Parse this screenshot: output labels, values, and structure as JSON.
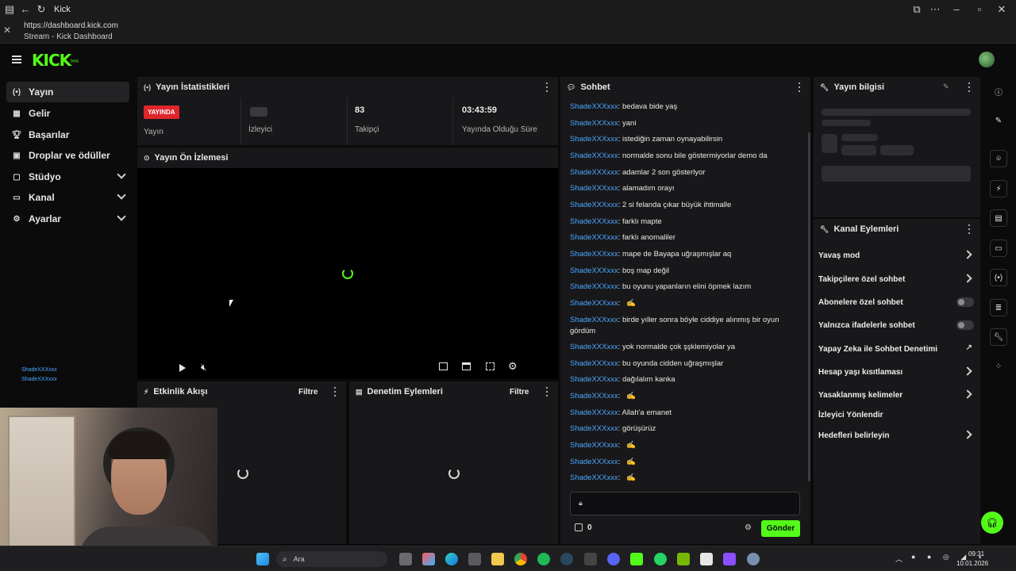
{
  "browser": {
    "tab_title": "Kick",
    "url": "https://dashboard.kick.com",
    "page_title": "Stream - Kick Dashboard"
  },
  "brand": {
    "logo_text": "KICK",
    "logo_sup": "beta",
    "accent": "#53fc18"
  },
  "sidebar": {
    "items": [
      {
        "label": "Yayın",
        "icon": "broadcast-icon",
        "active": true
      },
      {
        "label": "Gelir",
        "icon": "grid-icon"
      },
      {
        "label": "Başarılar",
        "icon": "trophy-icon"
      },
      {
        "label": "Droplar ve ödüller",
        "icon": "gift-icon"
      },
      {
        "label": "Stüdyo",
        "icon": "studio-icon",
        "expandable": true
      },
      {
        "label": "Kanal",
        "icon": "channel-icon",
        "expandable": true
      },
      {
        "label": "Ayarlar",
        "icon": "gear-icon",
        "expandable": true
      }
    ],
    "overlay_lines": [
      "ShadeXXXxxx",
      "ShadeXXXxxx"
    ]
  },
  "stats": {
    "title": "Yayın İstatistikleri",
    "live_badge": "YAYINDA",
    "cols": [
      {
        "value": "",
        "label": "Yayın"
      },
      {
        "value": "",
        "label": "İzleyici"
      },
      {
        "value": "83",
        "label": "Takipçi"
      },
      {
        "value": "03:43:59",
        "label": "Yayında Olduğu Süre"
      }
    ]
  },
  "preview": {
    "title": "Yayın Ön İzlemesi"
  },
  "activity": {
    "title": "Etkinlik Akışı",
    "filter": "Filtre"
  },
  "moderation": {
    "title": "Denetim Eylemleri",
    "filter": "Filtre"
  },
  "chat": {
    "title": "Sohbet",
    "messages": [
      {
        "user": "ShadeXXXxxx",
        "text": ": bedava bide yaş"
      },
      {
        "user": "ShadeXXXxxx",
        "text": ": yani"
      },
      {
        "user": "ShadeXXXxxx",
        "text": ": istediğin zaman oynayabilirsin"
      },
      {
        "user": "ShadeXXXxxx",
        "text": ": normalde sonu bile göstermiyorlar demo da"
      },
      {
        "user": "ShadeXXXxxx",
        "text": ": adamlar 2 son gösterlyor"
      },
      {
        "user": "ShadeXXXxxx",
        "text": ": alamadım orayı"
      },
      {
        "user": "ShadeXXXxxx",
        "text": ": 2 si felanda çıkar büyük ihtimalle"
      },
      {
        "user": "ShadeXXXxxx",
        "text": ": farklı mapte"
      },
      {
        "user": "ShadeXXXxxx",
        "text": ": farklı anomaliler"
      },
      {
        "user": "ShadeXXXxxx",
        "text": ": mape de Bayapa uğraşmışlar aq"
      },
      {
        "user": "ShadeXXXxxx",
        "text": ": boş map değil"
      },
      {
        "user": "ShadeXXXxxx",
        "text": ": bu oyunu yapanların elini öpmek lazım"
      },
      {
        "user": "ShadeXXXxxx",
        "text": ":"
      },
      {
        "user": "ShadeXXXxxx",
        "text": ": birde yıller sonra böyle ciddiye alınmış bir oyun gördüm"
      },
      {
        "user": "ShadeXXXxxx",
        "text": ": yok normalde çok şşklemiyolar ya"
      },
      {
        "user": "ShadeXXXxxx",
        "text": ": bu oyunda cidden uğraşmışlar"
      },
      {
        "user": "ShadeXXXxxx",
        "text": ": dağılalım kanka"
      },
      {
        "user": "ShadeXXXxxx",
        "text": ":"
      },
      {
        "user": "ShadeXXXxxx",
        "text": ": Allah'a emanet"
      },
      {
        "user": "ShadeXXXxxx",
        "text": ": görüşürüz"
      },
      {
        "user": "ShadeXXXxxx",
        "text": ":"
      },
      {
        "user": "ShadeXXXxxx",
        "text": ":"
      },
      {
        "user": "ShadeXXXxxx",
        "text": ":"
      }
    ],
    "points": "0",
    "send_label": "Gönder"
  },
  "stream_info": {
    "title": "Yayın bilgisi"
  },
  "channel_actions": {
    "title": "Kanal Eylemleri",
    "items": [
      {
        "label": "Yavaş mod",
        "control": "chevron"
      },
      {
        "label": "Takipçilere özel sohbet",
        "control": "chevron"
      },
      {
        "label": "Abonelere özel sohbet",
        "control": "toggle"
      },
      {
        "label": "Yalnızca ifadelerle sohbet",
        "control": "toggle"
      },
      {
        "label": "Yapay Zeka ile Sohbet Denetimi",
        "control": "external"
      },
      {
        "label": "Hesap yaşı kısıtlaması",
        "control": "chevron"
      },
      {
        "label": "Yasaklanmış kelimeler",
        "control": "chevron"
      },
      {
        "label": "İzleyici Yönlendir",
        "control": "none"
      },
      {
        "label": "Hedefleri belirleyin",
        "control": "chevron"
      }
    ]
  },
  "taskbar": {
    "search_label": "Ara",
    "time": "09:31",
    "date": "10.01.2026"
  }
}
